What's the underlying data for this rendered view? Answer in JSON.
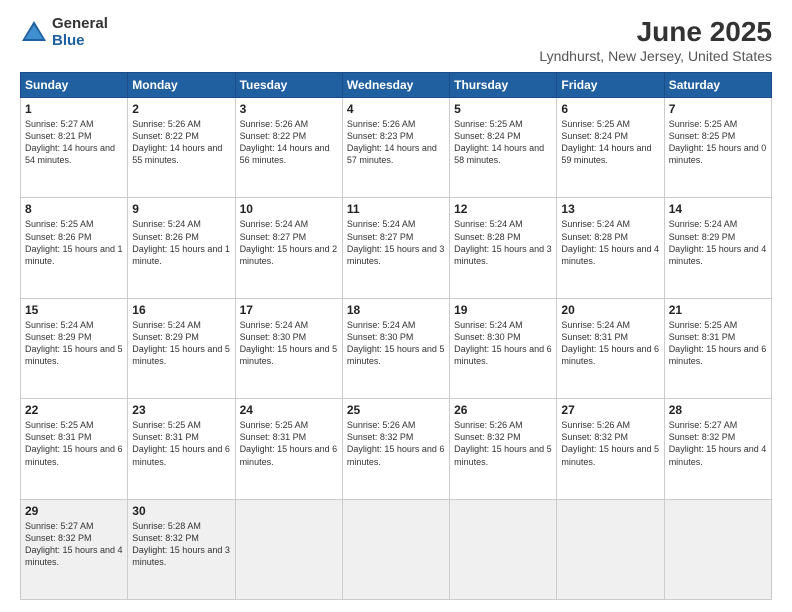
{
  "logo": {
    "general": "General",
    "blue": "Blue"
  },
  "title": {
    "month_year": "June 2025",
    "location": "Lyndhurst, New Jersey, United States"
  },
  "weekdays": [
    "Sunday",
    "Monday",
    "Tuesday",
    "Wednesday",
    "Thursday",
    "Friday",
    "Saturday"
  ],
  "weeks": [
    [
      {
        "day": "1",
        "sunrise": "5:27 AM",
        "sunset": "8:21 PM",
        "daylight": "14 hours and 54 minutes."
      },
      {
        "day": "2",
        "sunrise": "5:26 AM",
        "sunset": "8:22 PM",
        "daylight": "14 hours and 55 minutes."
      },
      {
        "day": "3",
        "sunrise": "5:26 AM",
        "sunset": "8:22 PM",
        "daylight": "14 hours and 56 minutes."
      },
      {
        "day": "4",
        "sunrise": "5:26 AM",
        "sunset": "8:23 PM",
        "daylight": "14 hours and 57 minutes."
      },
      {
        "day": "5",
        "sunrise": "5:25 AM",
        "sunset": "8:24 PM",
        "daylight": "14 hours and 58 minutes."
      },
      {
        "day": "6",
        "sunrise": "5:25 AM",
        "sunset": "8:24 PM",
        "daylight": "14 hours and 59 minutes."
      },
      {
        "day": "7",
        "sunrise": "5:25 AM",
        "sunset": "8:25 PM",
        "daylight": "15 hours and 0 minutes."
      }
    ],
    [
      {
        "day": "8",
        "sunrise": "5:25 AM",
        "sunset": "8:26 PM",
        "daylight": "15 hours and 1 minute."
      },
      {
        "day": "9",
        "sunrise": "5:24 AM",
        "sunset": "8:26 PM",
        "daylight": "15 hours and 1 minute."
      },
      {
        "day": "10",
        "sunrise": "5:24 AM",
        "sunset": "8:27 PM",
        "daylight": "15 hours and 2 minutes."
      },
      {
        "day": "11",
        "sunrise": "5:24 AM",
        "sunset": "8:27 PM",
        "daylight": "15 hours and 3 minutes."
      },
      {
        "day": "12",
        "sunrise": "5:24 AM",
        "sunset": "8:28 PM",
        "daylight": "15 hours and 3 minutes."
      },
      {
        "day": "13",
        "sunrise": "5:24 AM",
        "sunset": "8:28 PM",
        "daylight": "15 hours and 4 minutes."
      },
      {
        "day": "14",
        "sunrise": "5:24 AM",
        "sunset": "8:29 PM",
        "daylight": "15 hours and 4 minutes."
      }
    ],
    [
      {
        "day": "15",
        "sunrise": "5:24 AM",
        "sunset": "8:29 PM",
        "daylight": "15 hours and 5 minutes."
      },
      {
        "day": "16",
        "sunrise": "5:24 AM",
        "sunset": "8:29 PM",
        "daylight": "15 hours and 5 minutes."
      },
      {
        "day": "17",
        "sunrise": "5:24 AM",
        "sunset": "8:30 PM",
        "daylight": "15 hours and 5 minutes."
      },
      {
        "day": "18",
        "sunrise": "5:24 AM",
        "sunset": "8:30 PM",
        "daylight": "15 hours and 5 minutes."
      },
      {
        "day": "19",
        "sunrise": "5:24 AM",
        "sunset": "8:30 PM",
        "daylight": "15 hours and 6 minutes."
      },
      {
        "day": "20",
        "sunrise": "5:24 AM",
        "sunset": "8:31 PM",
        "daylight": "15 hours and 6 minutes."
      },
      {
        "day": "21",
        "sunrise": "5:25 AM",
        "sunset": "8:31 PM",
        "daylight": "15 hours and 6 minutes."
      }
    ],
    [
      {
        "day": "22",
        "sunrise": "5:25 AM",
        "sunset": "8:31 PM",
        "daylight": "15 hours and 6 minutes."
      },
      {
        "day": "23",
        "sunrise": "5:25 AM",
        "sunset": "8:31 PM",
        "daylight": "15 hours and 6 minutes."
      },
      {
        "day": "24",
        "sunrise": "5:25 AM",
        "sunset": "8:31 PM",
        "daylight": "15 hours and 6 minutes."
      },
      {
        "day": "25",
        "sunrise": "5:26 AM",
        "sunset": "8:32 PM",
        "daylight": "15 hours and 6 minutes."
      },
      {
        "day": "26",
        "sunrise": "5:26 AM",
        "sunset": "8:32 PM",
        "daylight": "15 hours and 5 minutes."
      },
      {
        "day": "27",
        "sunrise": "5:26 AM",
        "sunset": "8:32 PM",
        "daylight": "15 hours and 5 minutes."
      },
      {
        "day": "28",
        "sunrise": "5:27 AM",
        "sunset": "8:32 PM",
        "daylight": "15 hours and 4 minutes."
      }
    ],
    [
      {
        "day": "29",
        "sunrise": "5:27 AM",
        "sunset": "8:32 PM",
        "daylight": "15 hours and 4 minutes."
      },
      {
        "day": "30",
        "sunrise": "5:28 AM",
        "sunset": "8:32 PM",
        "daylight": "15 hours and 3 minutes."
      },
      null,
      null,
      null,
      null,
      null
    ]
  ]
}
